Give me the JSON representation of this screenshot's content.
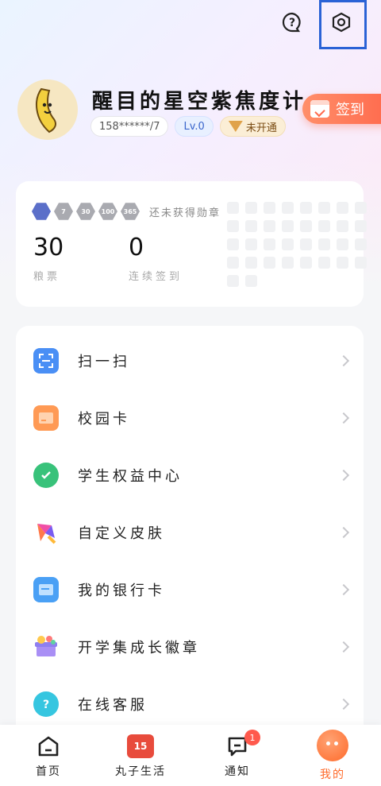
{
  "profile": {
    "nickname": "醒目的星空紫焦度计",
    "phone": "158******/7",
    "level": "Lv.0",
    "vip_status": "未开通",
    "signin_label": "签到"
  },
  "stats": {
    "medals_label": "还未获得勋章",
    "medal_marks": [
      "",
      "7",
      "30",
      "100",
      "365"
    ],
    "liangpiao_value": "30",
    "liangpiao_label": "粮票",
    "streak_value": "0",
    "streak_label": "连续签到"
  },
  "menu": [
    {
      "label": "扫一扫",
      "icon": "scan-icon",
      "color": "#4a8ff5"
    },
    {
      "label": "校园卡",
      "icon": "card-icon",
      "color": "#ff9a55"
    },
    {
      "label": "学生权益中心",
      "icon": "badge-check-icon",
      "color": "#38c27a"
    },
    {
      "label": "自定义皮肤",
      "icon": "skin-icon",
      "color": "#f04fa6"
    },
    {
      "label": "我的银行卡",
      "icon": "bank-card-icon",
      "color": "#4aa0f5"
    },
    {
      "label": "开学集成长徽章",
      "icon": "gift-box-icon",
      "color": "#8f7ff0"
    },
    {
      "label": "在线客服",
      "icon": "customer-service-icon",
      "color": "#36c6e0"
    }
  ],
  "tabs": [
    {
      "label": "首页",
      "icon": "home-icon"
    },
    {
      "label": "丸子生活",
      "icon": "promo-icon",
      "badge": "15"
    },
    {
      "label": "通知",
      "icon": "message-icon",
      "badge": "1"
    },
    {
      "label": "我的",
      "icon": "me-icon"
    }
  ],
  "colors": {
    "accent": "#ff6a2a",
    "highlight_box": "#2a62d6"
  }
}
